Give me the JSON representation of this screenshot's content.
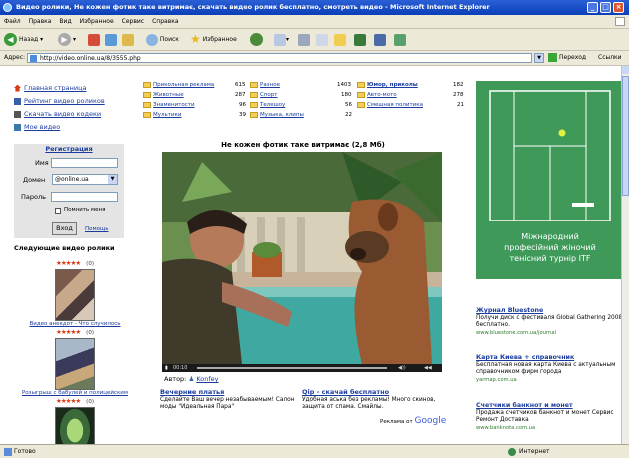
{
  "window": {
    "title": "Видео ролики, Не кожен фотик таке витримає, скачать видео ролик бесплатно, смотреть видео - Microsoft Internet Explorer"
  },
  "menu": [
    "Файл",
    "Правка",
    "Вид",
    "Избранное",
    "Сервис",
    "Справка"
  ],
  "toolbar": {
    "back": "Назад",
    "search": "Поиск",
    "favorites": "Избранное"
  },
  "address": {
    "label": "Адрес:",
    "url": "http://video.online.ua/8/3555.php",
    "go": "Переход",
    "links": "Ссылки"
  },
  "nav": [
    {
      "label": "Главная страница"
    },
    {
      "label": "Рейтинг видео роликов"
    },
    {
      "label": "Скачать видео кодеки"
    },
    {
      "label": "Мое видео"
    }
  ],
  "login": {
    "header": "Регистрация",
    "name_label": "Имя",
    "domain_label": "Домен",
    "domain_value": "@online.ua",
    "password_label": "Пароль",
    "remember": "Помнить меня",
    "login_button": "Вход",
    "help": "Помощь"
  },
  "next_videos": {
    "heading": "Следующие видео ролики",
    "items": [
      {
        "stars": "★★★★★",
        "votes": "(0)",
        "caption": "Видео анекдот - Что случилось"
      },
      {
        "stars": "★★★★★",
        "votes": "(0)",
        "caption": "Розыгрыш с бабулей и полицейским"
      },
      {
        "stars": "★★★★★",
        "votes": "(0)",
        "caption": ""
      }
    ]
  },
  "categories": [
    {
      "name": "Прикольная реклама",
      "count": "615"
    },
    {
      "name": "Животные",
      "count": "287"
    },
    {
      "name": "Знаменитости",
      "count": "96"
    },
    {
      "name": "Мультики",
      "count": "39"
    },
    {
      "name": "Разное",
      "count": "1403"
    },
    {
      "name": "Спорт",
      "count": "180"
    },
    {
      "name": "Телешоу",
      "count": "56"
    },
    {
      "name": "Музыка, клипы",
      "count": "22"
    },
    {
      "name": "Юмор, приколы",
      "count": "182"
    },
    {
      "name": "Авто-мото",
      "count": "278"
    },
    {
      "name": "Смешная политика",
      "count": "21"
    }
  ],
  "video": {
    "title": "Не кожен фотик таке витримає (2,8 Мб)",
    "time": "00:10",
    "author_label": "Автор:",
    "author": "Konfey"
  },
  "ads": [
    {
      "title": "Вечерние платья",
      "text": "Сделайте Ваш вечер незабываемым! Салон моды \"Идеальная Пара\""
    },
    {
      "title": "Qip - скачай бесплатно",
      "text": "Удобная аська без рекламы! Много скинов, защита от спама. Смайлы."
    }
  ],
  "google": {
    "prefix": "Реклама от",
    "brand": "Google"
  },
  "banner": {
    "lines": [
      "Міжнародний",
      "професійний жіночий",
      "тенісний турнір ITF"
    ]
  },
  "side_ads": [
    {
      "title": "Журнал Bluestone",
      "text": "Получи диск с фестиваля Global Gathering 2008 бесплатно.",
      "url": "www.bluestone.com.ua/journal"
    },
    {
      "title": "Карта Киева + справочник",
      "text": "Бесплатная новая карта Киева с актуальным справочником фирм города",
      "url": "yarmap.com.ua"
    },
    {
      "title": "Счетчики банкнот и монет",
      "text": "Продажа счетчиков банкнот и монет Сервис Ремонт Доставка",
      "url": "www.banknota.com.ua"
    }
  ],
  "status": {
    "left": "Готово",
    "zone": "Интернет"
  },
  "colors": {
    "title_bar": "#0b3fb8",
    "link": "#1a3ca0",
    "banner": "#3f9a5a",
    "stars": "#d83a14"
  }
}
